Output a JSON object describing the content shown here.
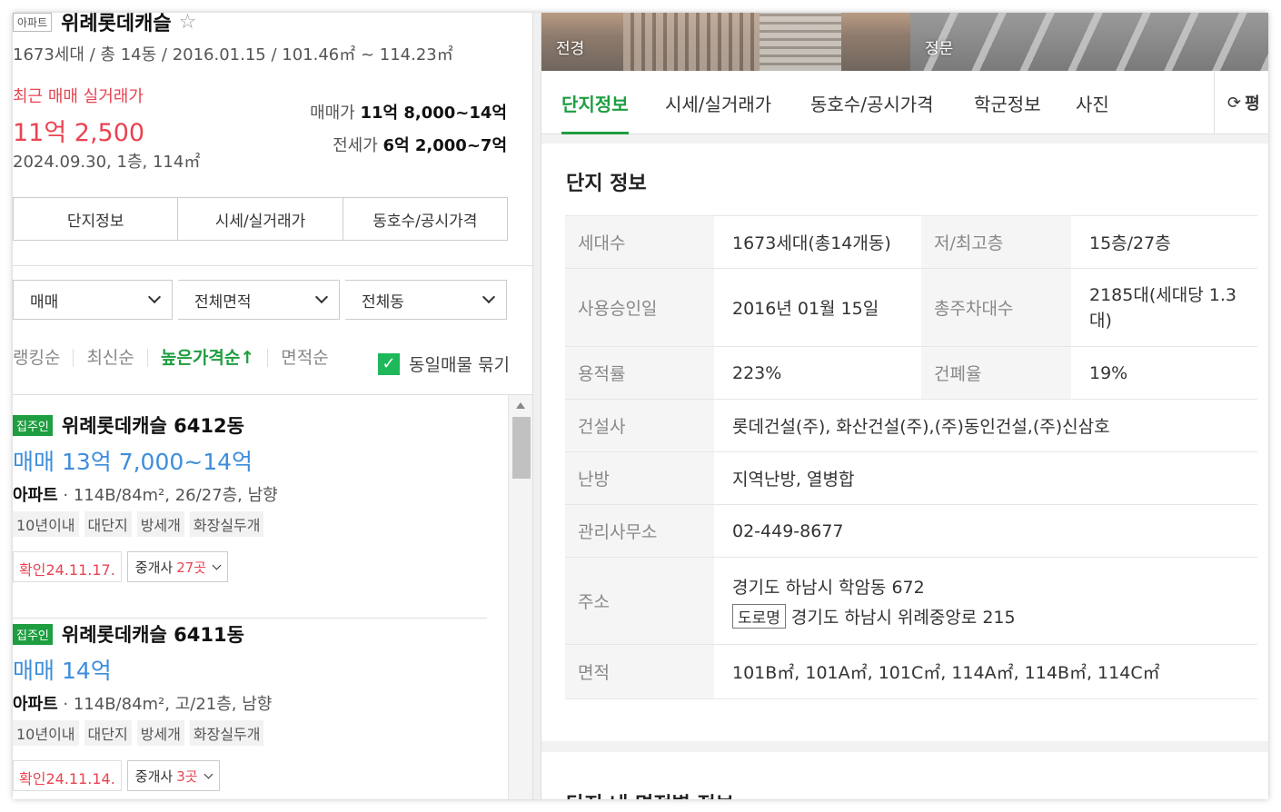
{
  "complex": {
    "type_tag": "아파트",
    "name": "위례롯데캐슬",
    "favorite_icon": "☆",
    "summary": "1673세대 / 총 14동 / 2016.01.15 / 101.46㎡ ~ 114.23㎡"
  },
  "recent_trade": {
    "label": "최근 매매 실거래가",
    "price": "11억 2,500",
    "meta": "2024.09.30, 1층, 114㎡"
  },
  "price_ranges": [
    {
      "label": "매매가",
      "value": "11억 8,000~14억"
    },
    {
      "label": "전세가",
      "value": "6억 2,000~7억"
    }
  ],
  "left_tabs": [
    "단지정보",
    "시세/실거래가",
    "동호수/공시가격"
  ],
  "filters": [
    "매매",
    "전체면적",
    "전체동"
  ],
  "sorts": [
    {
      "label": "랭킹순",
      "active": false
    },
    {
      "label": "최신순",
      "active": false
    },
    {
      "label": "높은가격순↑",
      "active": true
    },
    {
      "label": "면적순",
      "active": false
    }
  ],
  "group_checkbox": {
    "label": "동일매물 묶기",
    "check": "✓"
  },
  "listings": [
    {
      "owner_tag": "집주인",
      "name": "위례롯데캐슬 6412동",
      "price": "매매 13억 7,000~14억",
      "type": "아파트",
      "desc": " · 114B/84m², 26/27층, 남향",
      "tags": [
        "10년이내",
        "대단지",
        "방세개",
        "화장실두개"
      ],
      "confirm": "확인24.11.17.",
      "agents_prefix": "중개사 ",
      "agents_count": "27곳"
    },
    {
      "owner_tag": "집주인",
      "name": "위례롯데캐슬 6411동",
      "price": "매매 14억",
      "type": "아파트",
      "desc": " · 114B/84m², 고/21층, 남향",
      "tags": [
        "10년이내",
        "대단지",
        "방세개",
        "화장실두개"
      ],
      "confirm": "확인24.11.14.",
      "agents_prefix": "중개사 ",
      "agents_count": "3곳"
    }
  ],
  "photos": [
    {
      "label": "전경"
    },
    {
      "label": "정문"
    }
  ],
  "right_tabs": [
    {
      "label": "단지정보",
      "active": true
    },
    {
      "label": "시세/실거래가",
      "active": false
    },
    {
      "label": "동호수/공시가격",
      "active": false
    },
    {
      "label": "학군정보",
      "active": false
    },
    {
      "label": "사진",
      "active": false
    }
  ],
  "refresh": {
    "icon": "⟳",
    "label": "평"
  },
  "info_card": {
    "title": "단지 정보",
    "rows": {
      "households_k": "세대수",
      "households_v": "1673세대(총14개동)",
      "floors_k": "저/최고층",
      "floors_v": "15층/27층",
      "approval_k": "사용승인일",
      "approval_v": "2016년 01월 15일",
      "parking_k": "총주차대수",
      "parking_v": "2185대(세대당 1.3대)",
      "far_k": "용적률",
      "far_v": "223%",
      "bcr_k": "건폐율",
      "bcr_v": "19%",
      "builder_k": "건설사",
      "builder_v": "롯데건설(주), 화산건설(주),(주)동인건설,(주)신삼호",
      "heating_k": "난방",
      "heating_v": "지역난방, 열병합",
      "office_k": "관리사무소",
      "office_v": "02-449-8677",
      "address_k": "주소",
      "address_v": "경기도 하남시 학암동 672",
      "road_tag": "도로명",
      "road_v": "경기도 하남시 위례중앙로 215",
      "area_k": "면적",
      "area_v": "101B㎡, 101A㎡, 101C㎡, 114A㎡, 114B㎡, 114C㎡"
    }
  },
  "next_card": {
    "title": "단지 내 면적별 정보"
  }
}
